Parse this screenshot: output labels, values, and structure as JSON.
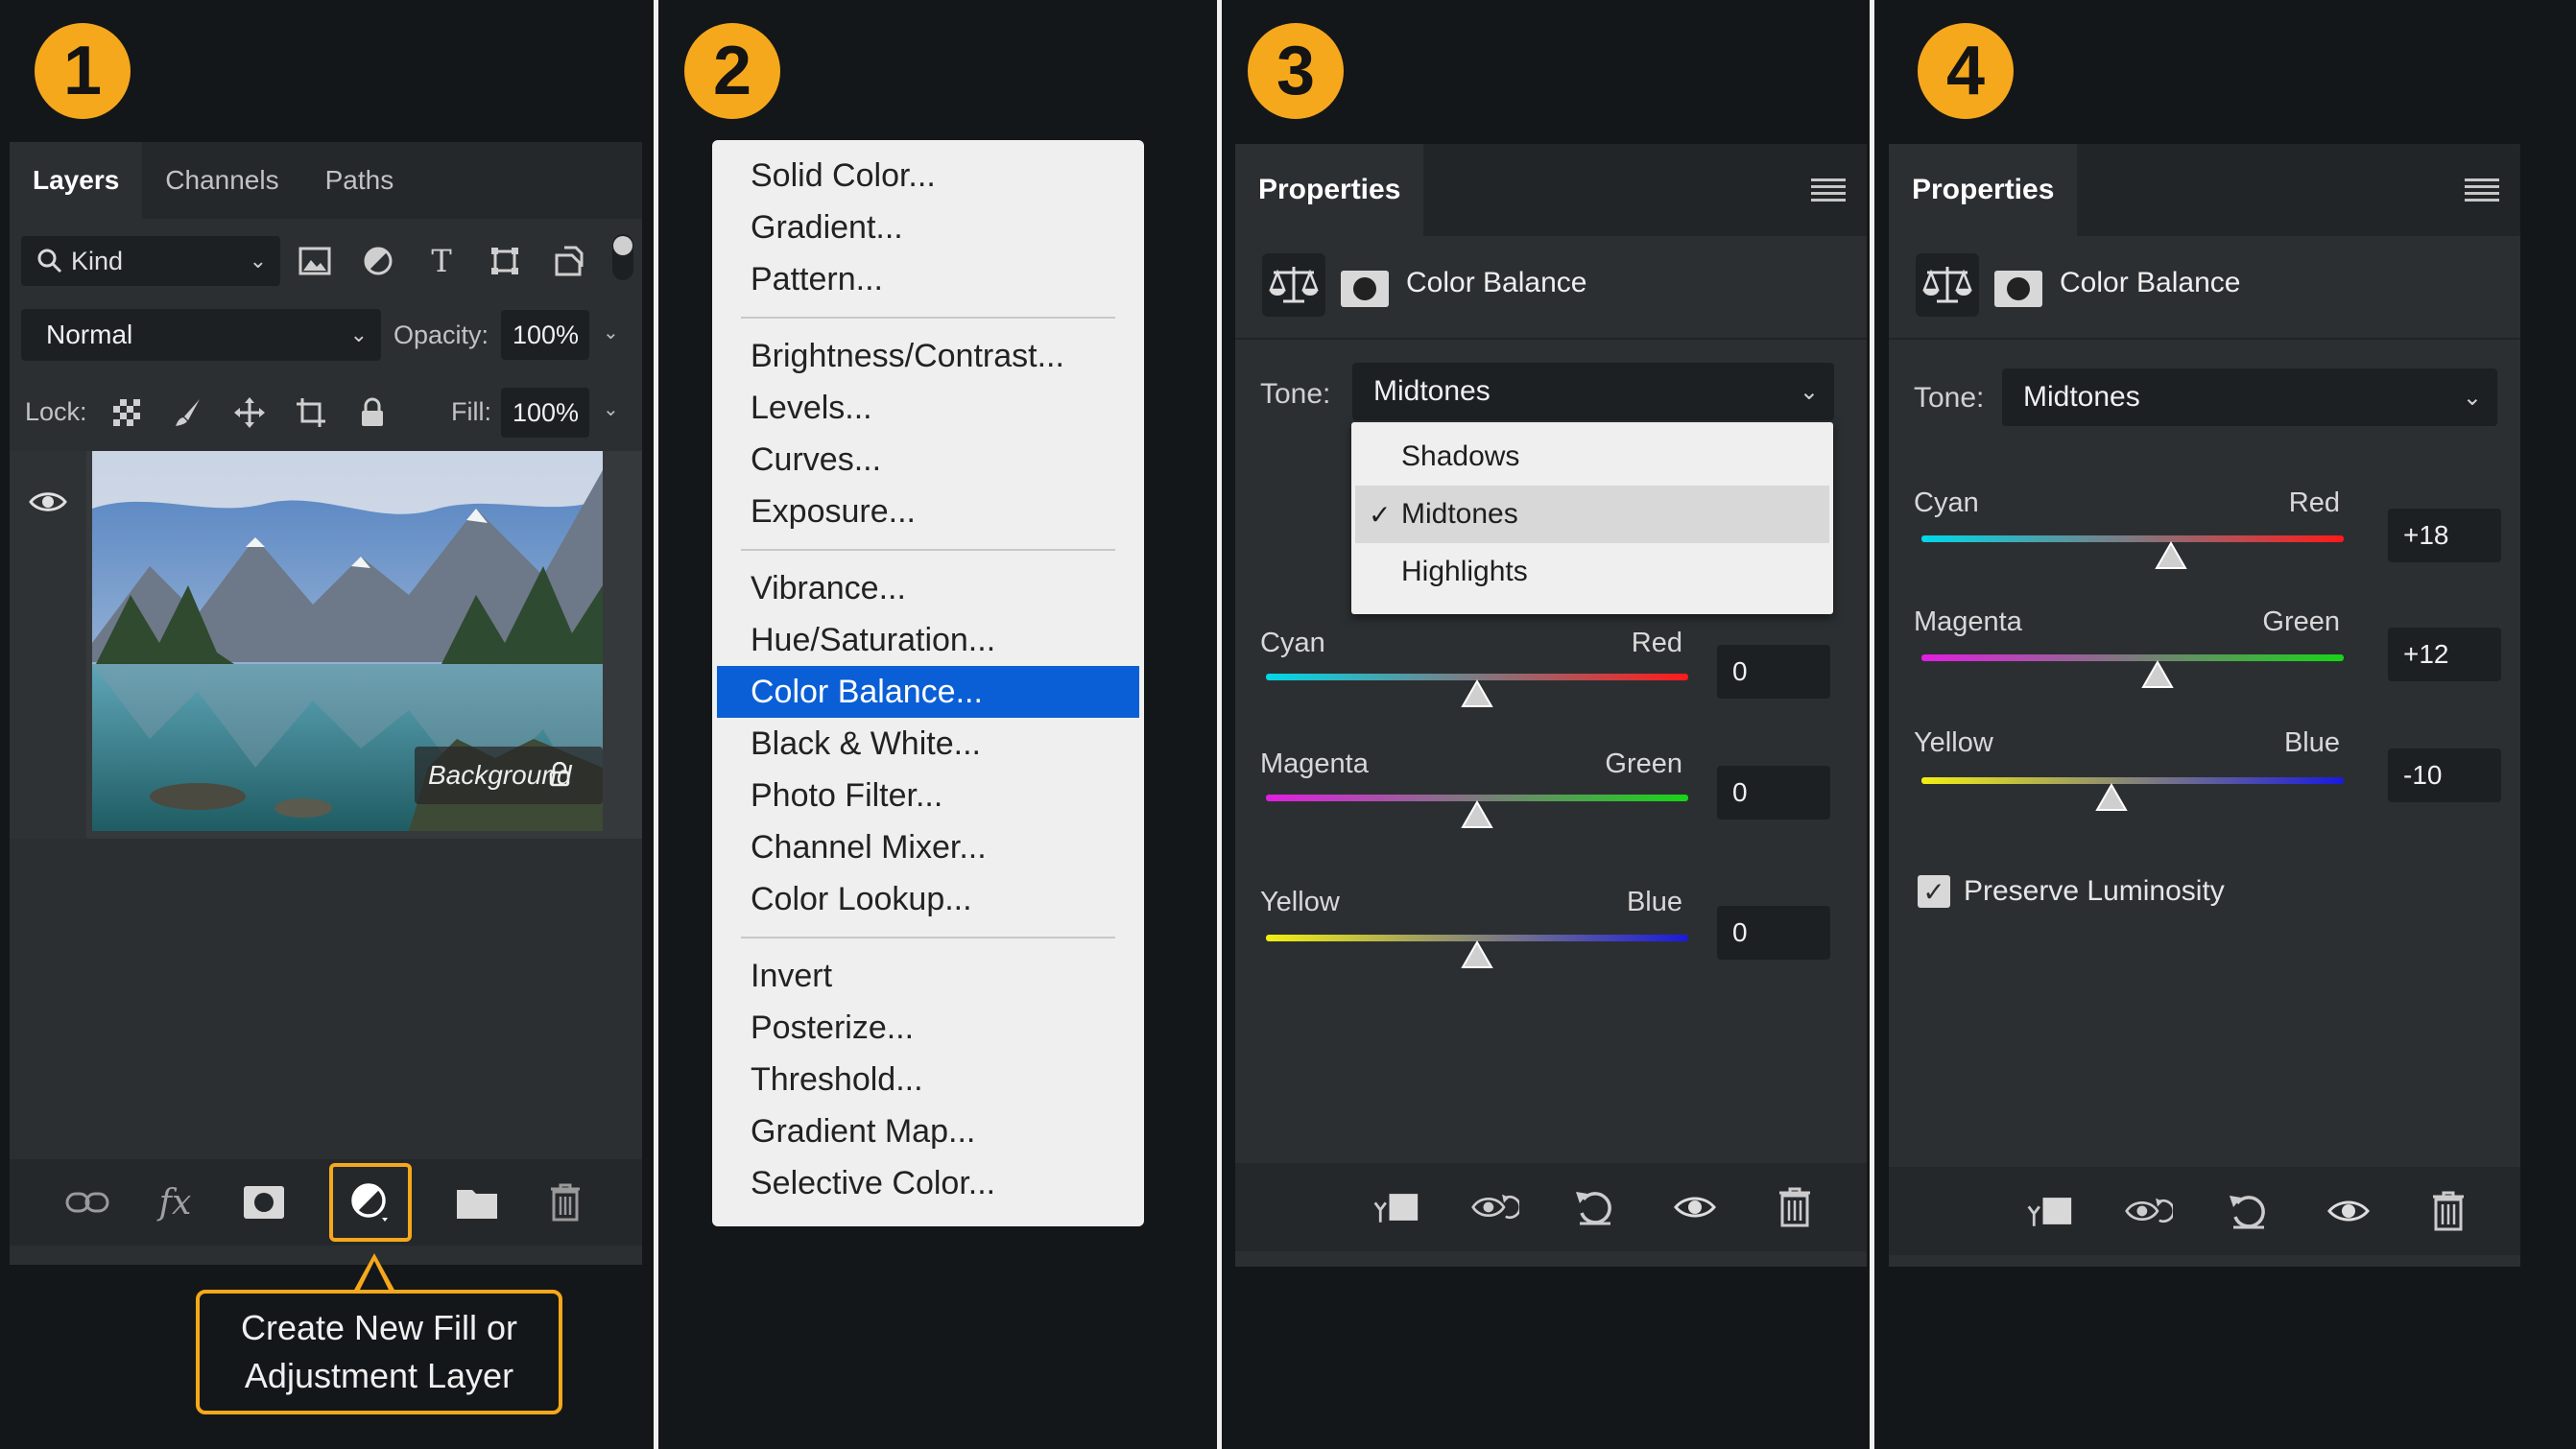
{
  "badges": [
    "1",
    "2",
    "3",
    "4"
  ],
  "layers_panel": {
    "tabs": [
      "Layers",
      "Channels",
      "Paths"
    ],
    "kind_filter": "Kind",
    "blend_mode": "Normal",
    "opacity_label": "Opacity:",
    "opacity_value": "100%",
    "lock_label": "Lock:",
    "fill_label": "Fill:",
    "fill_value": "100%",
    "layer_name": "Background",
    "callout": {
      "line1": "Create New Fill or",
      "line2": "Adjustment Layer"
    },
    "icons": {
      "filters": [
        "image-filter-icon",
        "adjustment-filter-icon",
        "type-filter-icon",
        "shape-filter-icon",
        "smart-object-filter-icon"
      ],
      "locks": [
        "lock-transparent-icon",
        "lock-image-icon",
        "lock-position-icon",
        "lock-artboard-icon",
        "lock-all-icon"
      ],
      "footer": [
        "link-layers-icon",
        "fx-icon",
        "add-mask-icon",
        "new-fill-adjustment-icon",
        "new-group-icon",
        "delete-layer-icon"
      ]
    }
  },
  "adjustment_menu": {
    "groups": [
      [
        "Solid Color...",
        "Gradient...",
        "Pattern..."
      ],
      [
        "Brightness/Contrast...",
        "Levels...",
        "Curves...",
        "Exposure..."
      ],
      [
        "Vibrance...",
        "Hue/Saturation...",
        "Color Balance...",
        "Black & White...",
        "Photo Filter...",
        "Channel Mixer...",
        "Color Lookup..."
      ],
      [
        "Invert",
        "Posterize...",
        "Threshold...",
        "Gradient Map...",
        "Selective Color..."
      ]
    ],
    "selected": "Color Balance..."
  },
  "properties_step3": {
    "title": "Properties",
    "adjustment": "Color Balance",
    "tone_label": "Tone:",
    "tone_value": "Midtones",
    "tone_options": [
      "Shadows",
      "Midtones",
      "Highlights"
    ],
    "tone_checked": "Midtones",
    "sliders": [
      {
        "left": "Cyan",
        "right": "Red",
        "value": "0",
        "level": 0
      },
      {
        "left": "Magenta",
        "right": "Green",
        "value": "0",
        "level": 0
      },
      {
        "left": "Yellow",
        "right": "Blue",
        "value": "0",
        "level": 0
      }
    ]
  },
  "properties_step4": {
    "title": "Properties",
    "adjustment": "Color Balance",
    "tone_label": "Tone:",
    "tone_value": "Midtones",
    "sliders": [
      {
        "left": "Cyan",
        "right": "Red",
        "value": "+18",
        "level": 18
      },
      {
        "left": "Magenta",
        "right": "Green",
        "value": "+12",
        "level": 12
      },
      {
        "left": "Yellow",
        "right": "Blue",
        "value": "-10",
        "level": -10
      }
    ],
    "preserve_luminosity": "Preserve Luminosity",
    "preserve_checked": true
  },
  "props_footer_icons": [
    "clip-to-layer-icon",
    "view-previous-icon",
    "reset-icon",
    "visibility-icon",
    "delete-icon"
  ],
  "colors": {
    "accent": "#f6a81c",
    "selection": "#0a5fd6",
    "panel": "#2c2f32",
    "background": "#141719"
  }
}
